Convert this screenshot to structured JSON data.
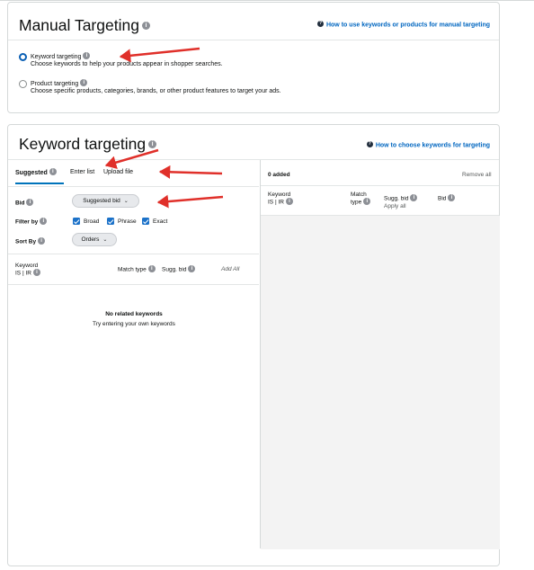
{
  "manual_targeting": {
    "title": "Manual Targeting",
    "help_link": "How to use keywords or products for manual targeting",
    "options": [
      {
        "label": "Keyword targeting",
        "description": "Choose keywords to help your products appear in shopper searches.",
        "selected": true
      },
      {
        "label": "Product targeting",
        "description": "Choose specific products, categories, brands, or other product features to target your ads.",
        "selected": false
      }
    ]
  },
  "keyword_targeting": {
    "title": "Keyword targeting",
    "help_link": "How to choose keywords for targeting",
    "tabs": [
      {
        "label": "Suggested",
        "active": true
      },
      {
        "label": "Enter list",
        "active": false
      },
      {
        "label": "Upload file",
        "active": false
      }
    ],
    "bid": {
      "label": "Bid",
      "value": "Suggested bid"
    },
    "filter_by": {
      "label": "Filter by",
      "options": [
        {
          "label": "Broad",
          "checked": true
        },
        {
          "label": "Phrase",
          "checked": true
        },
        {
          "label": "Exact",
          "checked": true
        }
      ]
    },
    "sort_by": {
      "label": "Sort By",
      "value": "Orders"
    },
    "left_columns": {
      "keyword": "Keyword",
      "is_ir": "IS | IR",
      "match_type": "Match type",
      "sugg_bid": "Sugg. bid",
      "add_all": "Add All"
    },
    "empty_state": {
      "title": "No related keywords",
      "subtitle": "Try entering your own keywords"
    },
    "right_panel": {
      "added_count": "0 added",
      "remove_all": "Remove all",
      "columns": {
        "keyword": "Keyword",
        "is_ir": "IS | IR",
        "match": "Match",
        "type": "type",
        "sugg_bid": "Sugg. bid",
        "apply_all": "Apply all",
        "bid": "Bid"
      }
    }
  },
  "colors": {
    "link": "#0066c0",
    "accent": "#0073bb",
    "checkbox": "#1c72c9",
    "annotation_arrow": "#e0302a"
  },
  "icons": [
    "info-icon",
    "help-circle-icon",
    "chevron-down-icon",
    "checkbox-checked-icon",
    "radio-selected-icon",
    "radio-unselected-icon",
    "red-annotation-arrow"
  ]
}
